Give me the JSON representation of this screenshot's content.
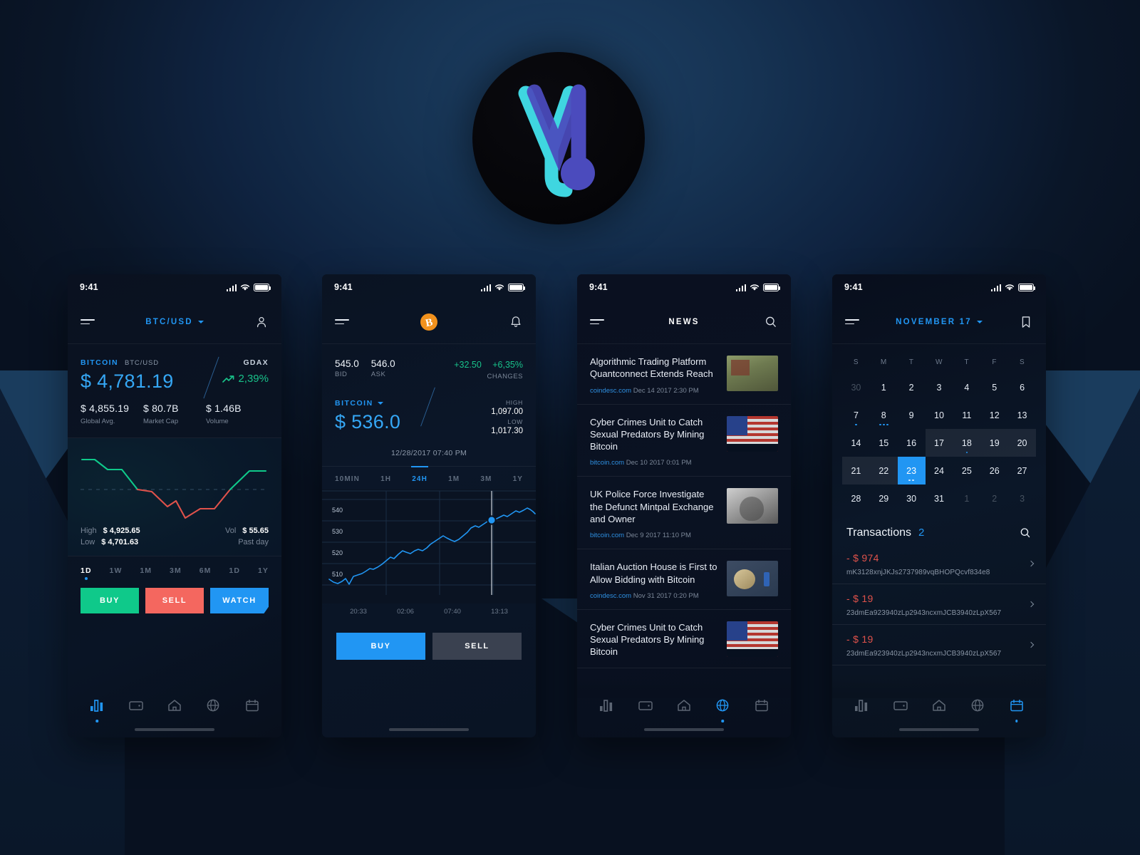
{
  "logo": {
    "name": "vl-monogram-logo",
    "cyan": "#3fd6e0",
    "purple": "#4b4bbd"
  },
  "theme": {
    "accent_blue": "#2196f3",
    "green": "#0fc98a",
    "red": "#f4675f",
    "bg_dark": "#0a1322"
  },
  "status_bar": {
    "time": "9:41"
  },
  "screen1": {
    "nav": {
      "title": "BTC/USD",
      "left_icon": "hamburger-icon",
      "right_icon": "user-icon"
    },
    "quote": {
      "name": "BITCOIN",
      "pair": "BTC/USD",
      "price": "$ 4,781.19",
      "exchange": "GDAX",
      "change": "2,39%"
    },
    "stats": [
      {
        "value": "$ 4,855.19",
        "label": "Global Avg."
      },
      {
        "value": "$ 80.7B",
        "label": "Market Cap"
      },
      {
        "value": "$ 1.46B",
        "label": "Volume"
      }
    ],
    "chart_meta": {
      "high_label": "High",
      "high_value": "$ 4,925.65",
      "low_label": "Low",
      "low_value": "$ 4,701.63",
      "vol_label": "Vol",
      "vol_value": "$ 55.65",
      "period_label": "Past day"
    },
    "periods": [
      "1D",
      "1W",
      "1M",
      "3M",
      "6M",
      "1D",
      "1Y"
    ],
    "active_period": "1D",
    "actions": [
      "BUY",
      "SELL",
      "WATCH"
    ],
    "tabs": [
      "chart-icon",
      "wallet-icon",
      "home-icon",
      "globe-icon",
      "calendar-icon"
    ],
    "active_tab": 0
  },
  "screen2": {
    "nav": {
      "title": "bitcoin-icon",
      "left_icon": "hamburger-icon",
      "right_icon": "bell-icon"
    },
    "bid": {
      "value": "545.0",
      "label": "BID"
    },
    "ask": {
      "value": "546.0",
      "label": "ASK"
    },
    "changes": {
      "abs": "+32.50",
      "pct": "+6,35%",
      "label": "CHANGES"
    },
    "price": {
      "name": "BITCOIN",
      "value": "$ 536.0"
    },
    "high": {
      "label": "HIGH",
      "value": "1,097.00"
    },
    "low": {
      "label": "LOW",
      "value": "1,017.30"
    },
    "timestamp": "12/28/2017 07:40 PM",
    "periods": [
      "10MIN",
      "1H",
      "24H",
      "1M",
      "3M",
      "1Y"
    ],
    "active_period": "24H",
    "actions": [
      "BUY",
      "SELL"
    ],
    "tabs": [
      "chart-icon",
      "wallet-icon",
      "home-icon",
      "globe-icon",
      "calendar-icon"
    ],
    "active_tab": 0
  },
  "screen3": {
    "nav": {
      "title": "NEWS",
      "left_icon": "hamburger-icon",
      "right_icon": "search-icon"
    },
    "items": [
      {
        "title": "Algorithmic Trading Platform Quantconnect Extends Reach",
        "source": "coindesc.com",
        "date": "Dec 14 2017 2:30 PM",
        "thumb": "park-photo"
      },
      {
        "title": "Cyber Crimes Unit to Catch Sexual Predators By Mining Bitcoin",
        "source": "bitcoin.com",
        "date": "Dec 10 2017 0:01 PM",
        "thumb": "usa-flag-photo"
      },
      {
        "title": "UK Police Force Investigate the Defunct Mintpal Exchange and Owner",
        "source": "bitcoin.com",
        "date": "Dec 9 2017 11:10 PM",
        "thumb": "portrait-photo"
      },
      {
        "title": "Italian Auction House is First to Allow Bidding with Bitcoin",
        "source": "coindesc.com",
        "date": "Nov 31 2017 0:20 PM",
        "thumb": "bitcoin-coin-photo"
      },
      {
        "title": "Cyber Crimes Unit to Catch Sexual Predators By Mining Bitcoin",
        "source": "",
        "date": "",
        "thumb": "usa-flag-photo"
      }
    ],
    "tabs": [
      "chart-icon",
      "wallet-icon",
      "home-icon",
      "globe-icon",
      "calendar-icon"
    ],
    "active_tab": 3
  },
  "screen4": {
    "nav": {
      "title": "NOVEMBER 17",
      "left_icon": "hamburger-icon",
      "right_icon": "bookmark-icon"
    },
    "dow": [
      "S",
      "M",
      "T",
      "W",
      "T",
      "F",
      "S"
    ],
    "weeks": [
      [
        {
          "d": "30",
          "mute": true
        },
        {
          "d": "1"
        },
        {
          "d": "2"
        },
        {
          "d": "3"
        },
        {
          "d": "4"
        },
        {
          "d": "5"
        },
        {
          "d": "6"
        }
      ],
      [
        {
          "d": "7",
          "dots": 1
        },
        {
          "d": "8",
          "dots": 3
        },
        {
          "d": "9"
        },
        {
          "d": "10"
        },
        {
          "d": "11"
        },
        {
          "d": "12"
        },
        {
          "d": "13"
        }
      ],
      [
        {
          "d": "14"
        },
        {
          "d": "15"
        },
        {
          "d": "16"
        },
        {
          "d": "17",
          "range": true
        },
        {
          "d": "18",
          "range": true,
          "dots": 1
        },
        {
          "d": "19",
          "range": true
        },
        {
          "d": "20",
          "range": true
        }
      ],
      [
        {
          "d": "21",
          "range": true
        },
        {
          "d": "22",
          "range": true
        },
        {
          "d": "23",
          "sel": true,
          "dots": 2
        },
        {
          "d": "24"
        },
        {
          "d": "25"
        },
        {
          "d": "26"
        },
        {
          "d": "27"
        }
      ],
      [
        {
          "d": "28"
        },
        {
          "d": "29"
        },
        {
          "d": "30"
        },
        {
          "d": "31"
        },
        {
          "d": "1",
          "mute": true
        },
        {
          "d": "2",
          "mute": true
        },
        {
          "d": "3",
          "mute": true
        }
      ]
    ],
    "transactions": {
      "title": "Transactions",
      "count": "2",
      "search_icon": "search-icon",
      "items": [
        {
          "amount": "- $ 974",
          "hash": "mK3128xnjJKJs2737989vqBHOPQcvf834e8"
        },
        {
          "amount": "- $ 19",
          "hash": "23dmEa923940zLp2943ncxmJCB3940zLpX567"
        },
        {
          "amount": "- $ 19",
          "hash": "23dmEa923940zLp2943ncxmJCB3940zLpX567"
        }
      ]
    },
    "tabs": [
      "chart-icon",
      "wallet-icon",
      "home-icon",
      "globe-icon",
      "calendar-icon"
    ],
    "active_tab": 4
  },
  "chart_data": [
    {
      "type": "line",
      "id": "screen1-price-line",
      "title": "BTC/USD past day",
      "values": [
        72,
        72,
        78,
        85,
        85,
        92,
        104,
        112,
        112,
        124,
        136,
        148,
        132,
        142,
        160,
        172,
        162,
        152,
        152,
        136,
        120,
        104,
        92
      ],
      "baseline_y": 112,
      "above_color": "#0fc98a",
      "below_color": "#e0524b",
      "ylim": [
        60,
        180
      ],
      "grid": false
    },
    {
      "type": "line",
      "id": "screen2-price-line",
      "title": "Bitcoin 24H",
      "yticks": [
        510,
        520,
        530,
        540
      ],
      "xticks": [
        "20:33",
        "02:06",
        "07:40",
        "13:13"
      ],
      "ylim": [
        504,
        546
      ],
      "marker": {
        "x_label": "07:40",
        "value": 536.0
      },
      "values": [
        509,
        508,
        507.5,
        508.5,
        509.8,
        507.2,
        510.5,
        511,
        511.8,
        512.5,
        513.8,
        513.4,
        514.2,
        515.6,
        517.4,
        519,
        518.4,
        520.5,
        521.8,
        521,
        520.4,
        521.6,
        522.4,
        521.8,
        523,
        524.4,
        525.8,
        527,
        528.2,
        527.4,
        526.6,
        526,
        527.2,
        528.6,
        530.4,
        532.2,
        533.4,
        532.6,
        534,
        535.2,
        536,
        536.4,
        537.2,
        538,
        537.4,
        538.6,
        539.8,
        539,
        540.2,
        541,
        540.4,
        539.6,
        540.2,
        539.4,
        538.2,
        536.8
      ],
      "grid": true,
      "line_color": "#2196f3"
    }
  ]
}
